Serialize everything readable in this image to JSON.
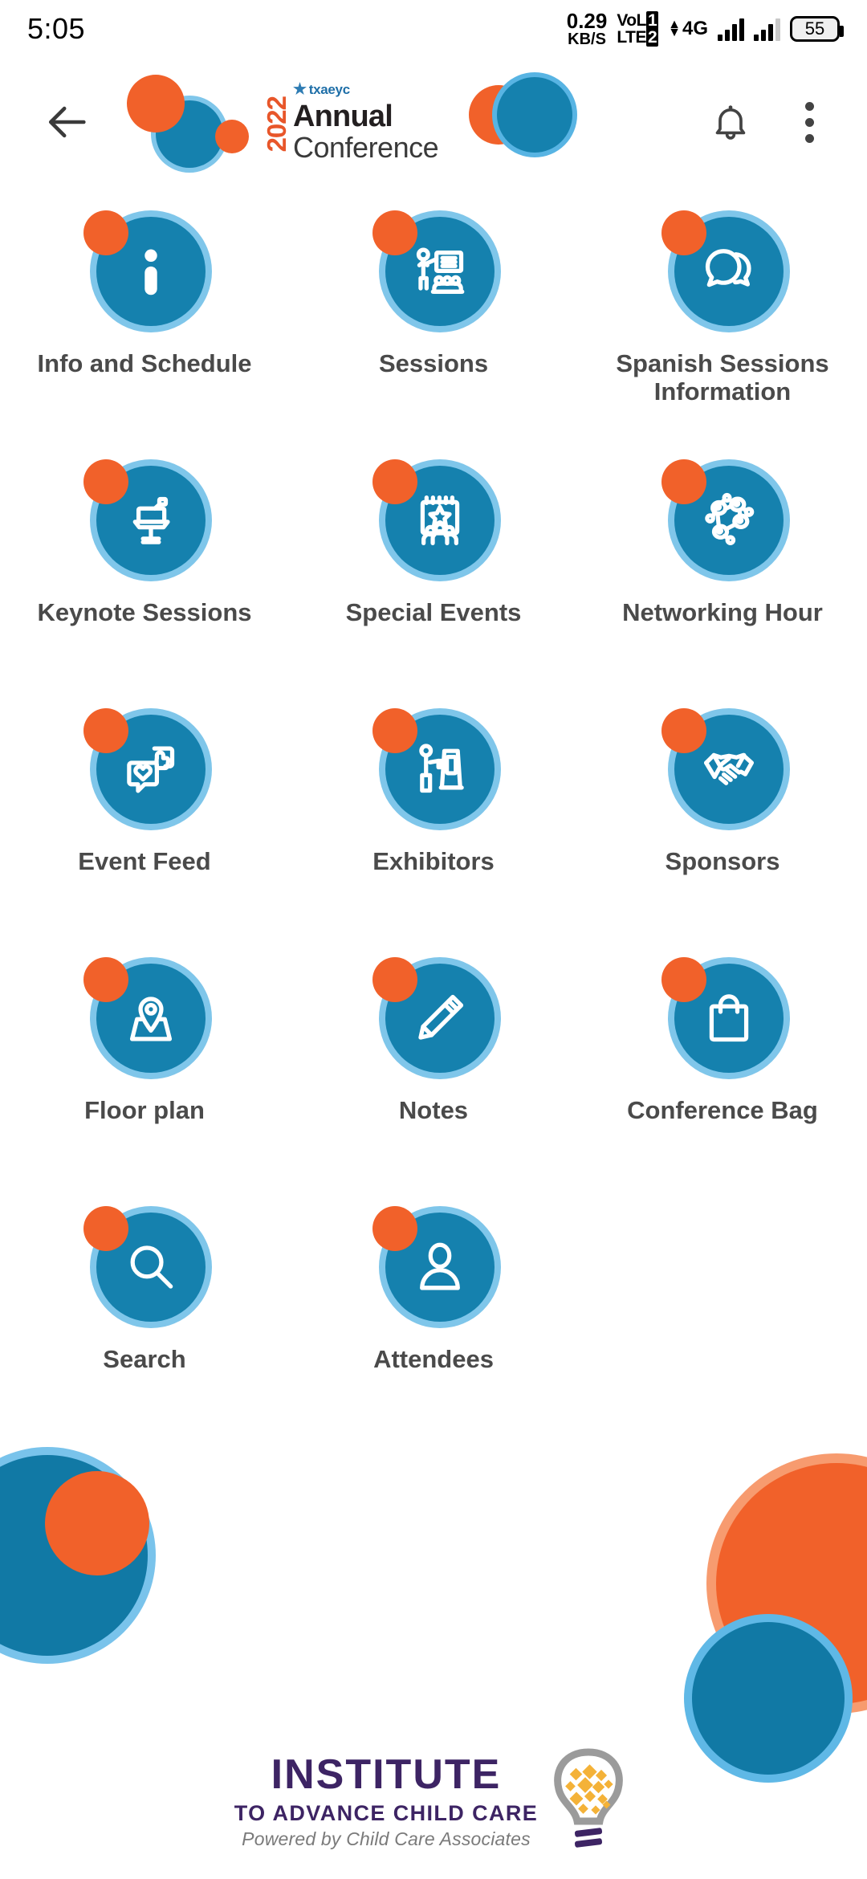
{
  "status_bar": {
    "clock": "5:05",
    "net_speed_value": "0.29",
    "net_speed_unit": "KB/S",
    "volte_line1": "VoL",
    "volte_line2": "LTE",
    "volte_badge1": "1",
    "volte_badge2": "2",
    "network_type": "4G",
    "battery_percent": "55"
  },
  "header": {
    "back_icon": "arrow-left-icon",
    "brand_year": "2022",
    "brand_org": "txaeyc",
    "brand_line1": "Annual",
    "brand_line2": "Conference",
    "notifications_icon": "bell-icon",
    "overflow_icon": "kebab-menu-icon"
  },
  "menu": {
    "items": [
      {
        "id": "info-and-schedule",
        "label": "Info and Schedule",
        "icon": "info-icon",
        "wrap": false
      },
      {
        "id": "sessions",
        "label": "Sessions",
        "icon": "presentation-icon",
        "wrap": false
      },
      {
        "id": "spanish-sessions-information",
        "label": "Spanish Sessions Information",
        "icon": "speech-bubbles-icon",
        "wrap": true
      },
      {
        "id": "keynote-sessions",
        "label": "Keynote Sessions",
        "icon": "lectern-icon",
        "wrap": false
      },
      {
        "id": "special-events",
        "label": "Special Events",
        "icon": "calendar-star-icon",
        "wrap": false
      },
      {
        "id": "networking-hour",
        "label": "Networking Hour",
        "icon": "network-nodes-icon",
        "wrap": false
      },
      {
        "id": "event-feed",
        "label": "Event Feed",
        "icon": "feed-heart-icon",
        "wrap": false
      },
      {
        "id": "exhibitors",
        "label": "Exhibitors",
        "icon": "exhibitor-booth-icon",
        "wrap": false
      },
      {
        "id": "sponsors",
        "label": "Sponsors",
        "icon": "handshake-icon",
        "wrap": false
      },
      {
        "id": "floor-plan",
        "label": "Floor plan",
        "icon": "map-pin-icon",
        "wrap": false
      },
      {
        "id": "notes",
        "label": "Notes",
        "icon": "pencil-icon",
        "wrap": false
      },
      {
        "id": "conference-bag",
        "label": "Conference Bag",
        "icon": "shopping-bag-icon",
        "wrap": false
      },
      {
        "id": "search",
        "label": "Search",
        "icon": "search-icon",
        "wrap": false
      },
      {
        "id": "attendees",
        "label": "Attendees",
        "icon": "person-icon",
        "wrap": false
      }
    ]
  },
  "footer": {
    "logo_line1": "INSTITUTE",
    "logo_line2": "TO ADVANCE CHILD CARE",
    "logo_line3": "Powered by Child Care Associates",
    "logo_icon": "lightbulb-icon"
  },
  "colors": {
    "brand_blue": "#1581AE",
    "brand_blue_ring": "#7FC6EA",
    "brand_orange": "#F1612A",
    "label_gray": "#4A4A4A",
    "footer_purple": "#3D2464",
    "footer_gray": "#7A7A7A",
    "bulb_gray": "#9B9B9B",
    "bulb_gold": "#F4B238"
  }
}
